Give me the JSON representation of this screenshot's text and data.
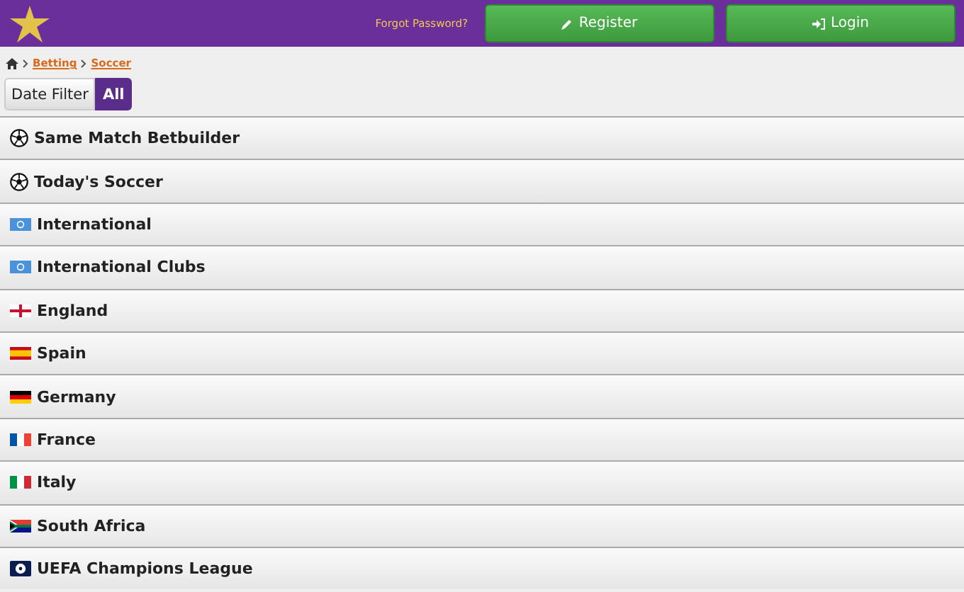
{
  "header": {
    "forgot_link": "Forgot Password?",
    "buttons": [
      {
        "kind": "register",
        "label": "Register"
      },
      {
        "kind": "login",
        "label": "Login"
      }
    ]
  },
  "breadcrumb": [
    "Betting",
    "Soccer"
  ],
  "date_filter": {
    "label": "Date Filter",
    "options": [
      {
        "label": "All",
        "selected": true
      }
    ]
  },
  "categories": [
    {
      "label": "Same Match Betbuilder",
      "kind": "ball"
    },
    {
      "label": "Today's Soccer",
      "kind": "ball"
    },
    {
      "label": "International",
      "kind": "un"
    },
    {
      "label": "International Clubs",
      "kind": "un"
    },
    {
      "label": "England",
      "kind": "england"
    },
    {
      "label": "Spain",
      "kind": "spain"
    },
    {
      "label": "Germany",
      "kind": "germany"
    },
    {
      "label": "France",
      "kind": "france"
    },
    {
      "label": "Italy",
      "kind": "italy"
    },
    {
      "label": "South Africa",
      "kind": "southafrica"
    },
    {
      "label": "UEFA Champions League",
      "kind": "ucl"
    }
  ]
}
